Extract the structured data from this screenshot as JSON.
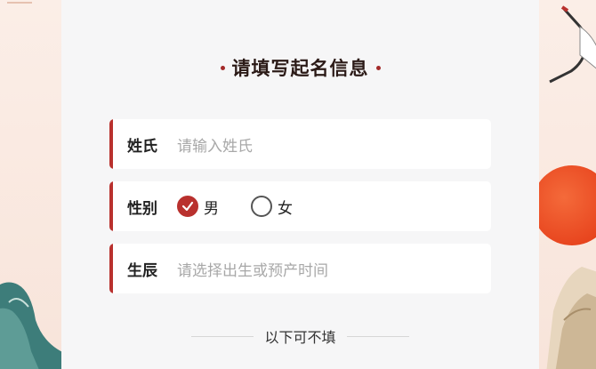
{
  "form": {
    "title": "请填写起名信息",
    "surname": {
      "label": "姓氏",
      "placeholder": "请输入姓氏"
    },
    "gender": {
      "label": "性别",
      "options": [
        {
          "label": "男",
          "checked": true
        },
        {
          "label": "女",
          "checked": false
        }
      ]
    },
    "birth": {
      "label": "生辰",
      "placeholder": "请选择出生或预产时间"
    },
    "optional_divider": "以下可不填"
  },
  "colors": {
    "accent": "#b9312e",
    "card_bg": "#f6f6f7",
    "page_bg": "#fbeee7"
  }
}
